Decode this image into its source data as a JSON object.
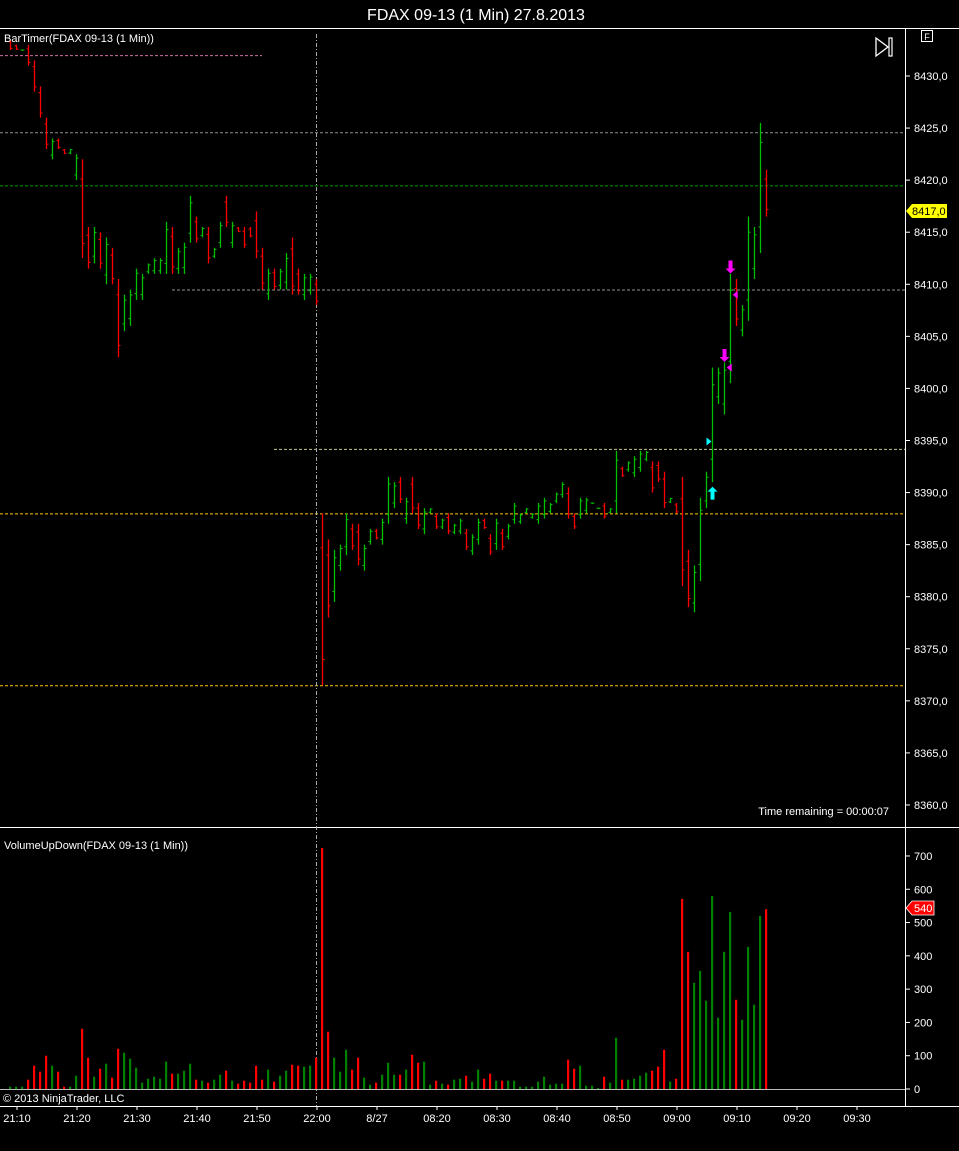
{
  "window": {
    "title": "FDAX 09-13 (1 Min)  27.8.2013"
  },
  "price_panel": {
    "indicator_label": "BarTimer(FDAX 09-13 (1 Min))",
    "time_remaining": "Time remaining = 00:00:07",
    "last_price_tag": "8417,0",
    "scroll_end_icon": "scroll-to-end-icon",
    "f_button": "F"
  },
  "volume_panel": {
    "indicator_label": "VolumeUpDown(FDAX 09-13 (1 Min))",
    "last_volume_tag": "540",
    "copyright": "© 2013 NinjaTrader, LLC"
  },
  "colors": {
    "up": "#00c000",
    "down": "#ff0000",
    "background": "#000000",
    "axis": "#ffffff",
    "price_tag": "#ffff00",
    "marker_buy": "#00ffff",
    "marker_sell": "#ff00ff"
  },
  "chart_data": [
    {
      "type": "ohlc",
      "title": "FDAX 09-13 (1 Min) 27.8.2013",
      "ylim": [
        8357,
        8436
      ],
      "y_ticks": [
        "8430,0",
        "8425,0",
        "8420,0",
        "8415,0",
        "8410,0",
        "8405,0",
        "8400,0",
        "8395,0",
        "8390,0",
        "8385,0",
        "8380,0",
        "8375,0",
        "8370,0",
        "8365,0",
        "8360,0"
      ],
      "y_tick_values": [
        8430,
        8425,
        8420,
        8415,
        8410,
        8405,
        8400,
        8395,
        8390,
        8385,
        8380,
        8375,
        8370,
        8365,
        8360
      ],
      "x_ticks": [
        "21:10",
        "21:20",
        "21:30",
        "21:40",
        "21:50",
        "22:00",
        "8/27",
        "08:20",
        "08:30",
        "08:40",
        "08:50",
        "09:00",
        "09:10",
        "09:20",
        "09:30"
      ],
      "x_tick_bar_index": [
        1,
        11,
        21,
        31,
        41,
        51,
        61,
        71,
        81,
        91,
        101,
        111,
        121,
        131,
        141
      ],
      "bars_format": [
        "high",
        "low",
        "direction"
      ],
      "bars": [
        [
          8433.5,
          8432.5,
          "d"
        ],
        [
          8433,
          8432.5,
          "d"
        ],
        [
          8432.5,
          8432.5,
          "u"
        ],
        [
          8433,
          8431,
          "d"
        ],
        [
          8431.5,
          8428.5,
          "d"
        ],
        [
          8429,
          8426,
          "d"
        ],
        [
          8426,
          8423,
          "d"
        ],
        [
          8424,
          8422,
          "u"
        ],
        [
          8424,
          8423,
          "d"
        ],
        [
          8423,
          8422.5,
          "d"
        ],
        [
          8423,
          8422.5,
          "u"
        ],
        [
          8422.5,
          8420,
          "u"
        ],
        [
          8422,
          8412.5,
          "d"
        ],
        [
          8415.5,
          8411.5,
          "d"
        ],
        [
          8415.5,
          8412,
          "u"
        ],
        [
          8415,
          8411.5,
          "d"
        ],
        [
          8414.5,
          8410,
          "u"
        ],
        [
          8413.5,
          8410,
          "d"
        ],
        [
          8410.5,
          8403,
          "d"
        ],
        [
          8409,
          8405.5,
          "u"
        ],
        [
          8409.5,
          8406,
          "u"
        ],
        [
          8411.5,
          8408.5,
          "u"
        ],
        [
          8411,
          8408.5,
          "u"
        ],
        [
          8412,
          8411,
          "u"
        ],
        [
          8412.5,
          8411,
          "u"
        ],
        [
          8412.5,
          8411,
          "u"
        ],
        [
          8416,
          8411,
          "u"
        ],
        [
          8415.5,
          8411,
          "d"
        ],
        [
          8413.5,
          8411,
          "u"
        ],
        [
          8414,
          8411,
          "u"
        ],
        [
          8418.5,
          8414,
          "u"
        ],
        [
          8416.5,
          8414,
          "d"
        ],
        [
          8415.5,
          8414.5,
          "u"
        ],
        [
          8415.5,
          8412,
          "d"
        ],
        [
          8413.5,
          8412.5,
          "u"
        ],
        [
          8416,
          8413.5,
          "u"
        ],
        [
          8418.5,
          8415.5,
          "d"
        ],
        [
          8416,
          8413.5,
          "u"
        ],
        [
          8415.5,
          8415,
          "d"
        ],
        [
          8415.5,
          8413.5,
          "d"
        ],
        [
          8415.5,
          8414.5,
          "d"
        ],
        [
          8417,
          8412.5,
          "d"
        ],
        [
          8413.5,
          8409.5,
          "d"
        ],
        [
          8411.5,
          8408.5,
          "u"
        ],
        [
          8411.5,
          8409.5,
          "d"
        ],
        [
          8411.5,
          8409.5,
          "u"
        ],
        [
          8413,
          8409.5,
          "u"
        ],
        [
          8414.5,
          8409,
          "d"
        ],
        [
          8411.5,
          8409,
          "d"
        ],
        [
          8411,
          8408.5,
          "u"
        ],
        [
          8411,
          8409,
          "u"
        ],
        [
          8410.5,
          8408,
          "d"
        ],
        [
          8388,
          8371.5,
          "d"
        ],
        [
          8385.5,
          8378,
          "d"
        ],
        [
          8384.5,
          8379.5,
          "u"
        ],
        [
          8385,
          8382.5,
          "u"
        ],
        [
          8388,
          8384,
          "u"
        ],
        [
          8387,
          8384.5,
          "d"
        ],
        [
          8387,
          8383,
          "d"
        ],
        [
          8385,
          8382.5,
          "u"
        ],
        [
          8386.5,
          8385,
          "u"
        ],
        [
          8386.5,
          8385.5,
          "d"
        ],
        [
          8387.5,
          8385,
          "u"
        ],
        [
          8391.5,
          8387,
          "u"
        ],
        [
          8391,
          8388.5,
          "u"
        ],
        [
          8391.5,
          8389,
          "d"
        ],
        [
          8389.5,
          8387,
          "u"
        ],
        [
          8391.5,
          8388,
          "d"
        ],
        [
          8389,
          8386.5,
          "d"
        ],
        [
          8388.5,
          8386,
          "u"
        ],
        [
          8388.5,
          8388,
          "u"
        ],
        [
          8388,
          8386.5,
          "d"
        ],
        [
          8387.5,
          8386.5,
          "u"
        ],
        [
          8388,
          8386,
          "d"
        ],
        [
          8387,
          8386,
          "u"
        ],
        [
          8387.5,
          8386,
          "u"
        ],
        [
          8386.5,
          8384.5,
          "d"
        ],
        [
          8386,
          8384,
          "u"
        ],
        [
          8387.5,
          8385,
          "u"
        ],
        [
          8387.5,
          8386.5,
          "d"
        ],
        [
          8386,
          8384,
          "d"
        ],
        [
          8387.5,
          8384.5,
          "u"
        ],
        [
          8386.5,
          8384.5,
          "d"
        ],
        [
          8387,
          8385.5,
          "u"
        ],
        [
          8389,
          8387,
          "u"
        ],
        [
          8388,
          8387,
          "u"
        ],
        [
          8388.5,
          8388,
          "u"
        ],
        [
          8388,
          8387.5,
          "u"
        ],
        [
          8389,
          8387,
          "u"
        ],
        [
          8389.5,
          8387.5,
          "u"
        ],
        [
          8389,
          8388,
          "u"
        ],
        [
          8390,
          8389,
          "u"
        ],
        [
          8391,
          8389.5,
          "u"
        ],
        [
          8390.5,
          8387.5,
          "d"
        ],
        [
          8388,
          8386.5,
          "d"
        ],
        [
          8389.5,
          8387.5,
          "u"
        ],
        [
          8389.5,
          8388,
          "u"
        ],
        [
          8389,
          8389,
          "u"
        ],
        [
          8388.5,
          8388.5,
          "u"
        ],
        [
          8389,
          8387.5,
          "d"
        ],
        [
          8388.5,
          8388,
          "u"
        ],
        [
          8394,
          8388,
          "u"
        ],
        [
          8392.5,
          8391.5,
          "d"
        ],
        [
          8393,
          8392,
          "u"
        ],
        [
          8393.5,
          8391.5,
          "u"
        ],
        [
          8394,
          8392,
          "u"
        ],
        [
          8394,
          8393,
          "u"
        ],
        [
          8393,
          8390,
          "d"
        ],
        [
          8393,
          8391,
          "d"
        ],
        [
          8392,
          8388.5,
          "d"
        ],
        [
          8389.5,
          8389,
          "u"
        ],
        [
          8389,
          8388,
          "d"
        ],
        [
          8391.5,
          8381,
          "d"
        ],
        [
          8384.5,
          8379,
          "d"
        ],
        [
          8383,
          8378.5,
          "u"
        ],
        [
          8389.5,
          8381.5,
          "u"
        ],
        [
          8392,
          8388.5,
          "u"
        ],
        [
          8402,
          8391,
          "u"
        ],
        [
          8402,
          8398.5,
          "u"
        ],
        [
          8402.5,
          8397.5,
          "u"
        ],
        [
          8411,
          8400.5,
          "u"
        ],
        [
          8410.5,
          8406,
          "d"
        ],
        [
          8408,
          8405,
          "u"
        ],
        [
          8416.5,
          8406.5,
          "u"
        ],
        [
          8415.5,
          8410.5,
          "u"
        ],
        [
          8425.5,
          8413,
          "u"
        ],
        [
          8421,
          8416.5,
          "d"
        ]
      ],
      "last_price": 8417.0,
      "horizontal_lines": [
        {
          "price": 8432.0,
          "color": "#d070a0",
          "from_bar": 0,
          "to_bar": 42
        },
        {
          "price": 8424.6,
          "color": "#909090",
          "from_bar": 0,
          "to_bar": null
        },
        {
          "price": 8419.5,
          "color": "#00a000",
          "from_bar": 0,
          "to_bar": null
        },
        {
          "price": 8409.5,
          "color": "#909090",
          "from_bar": 27,
          "to_bar": null
        },
        {
          "price": 8394.2,
          "color": "#c8c890",
          "from_bar": 44,
          "to_bar": null
        },
        {
          "price": 8388.0,
          "color": "#ffc800",
          "from_bar": 0,
          "to_bar": null
        },
        {
          "price": 8371.5,
          "color": "#ffc800",
          "from_bar": 0,
          "to_bar": null
        }
      ],
      "session_break_bar": 51,
      "markers": [
        {
          "type": "arrow-up",
          "bar": 117,
          "price": 8389.8,
          "color": "#00ffff"
        },
        {
          "type": "triangle-right",
          "bar": 116.5,
          "price": 8394.9,
          "color": "#00ffff"
        },
        {
          "type": "arrow-down",
          "bar": 120,
          "price": 8411.8,
          "color": "#ff00ff"
        },
        {
          "type": "arrow-down",
          "bar": 119,
          "price": 8403.3,
          "color": "#ff00ff"
        },
        {
          "type": "triangle-left",
          "bar": 120.7,
          "price": 8409.0,
          "color": "#ff00ff"
        },
        {
          "type": "triangle-left",
          "bar": 119.7,
          "price": 8402.0,
          "color": "#ff00ff"
        }
      ]
    },
    {
      "type": "bar",
      "title": "VolumeUpDown(FDAX 09-13 (1 Min))",
      "ylim": [
        0,
        760
      ],
      "y_ticks": [
        "700",
        "600",
        "500",
        "400",
        "300",
        "200",
        "100",
        "0"
      ],
      "y_tick_values": [
        700,
        600,
        500,
        400,
        300,
        200,
        100,
        0
      ],
      "volumes_format": [
        "volume",
        "direction"
      ],
      "volumes": [
        [
          7,
          "u"
        ],
        [
          7,
          "u"
        ],
        [
          7,
          "u"
        ],
        [
          28,
          "d"
        ],
        [
          70,
          "d"
        ],
        [
          52,
          "d"
        ],
        [
          100,
          "d"
        ],
        [
          70,
          "u"
        ],
        [
          52,
          "d"
        ],
        [
          7,
          "d"
        ],
        [
          7,
          "u"
        ],
        [
          40,
          "u"
        ],
        [
          181,
          "d"
        ],
        [
          94,
          "d"
        ],
        [
          37,
          "u"
        ],
        [
          61,
          "d"
        ],
        [
          76,
          "u"
        ],
        [
          34,
          "d"
        ],
        [
          121,
          "d"
        ],
        [
          109,
          "u"
        ],
        [
          91,
          "u"
        ],
        [
          64,
          "u"
        ],
        [
          19,
          "u"
        ],
        [
          31,
          "u"
        ],
        [
          37,
          "u"
        ],
        [
          31,
          "u"
        ],
        [
          82,
          "u"
        ],
        [
          46,
          "d"
        ],
        [
          46,
          "u"
        ],
        [
          55,
          "u"
        ],
        [
          76,
          "u"
        ],
        [
          28,
          "d"
        ],
        [
          25,
          "u"
        ],
        [
          19,
          "d"
        ],
        [
          28,
          "u"
        ],
        [
          43,
          "u"
        ],
        [
          55,
          "d"
        ],
        [
          25,
          "u"
        ],
        [
          16,
          "d"
        ],
        [
          25,
          "d"
        ],
        [
          19,
          "d"
        ],
        [
          70,
          "d"
        ],
        [
          28,
          "d"
        ],
        [
          58,
          "u"
        ],
        [
          22,
          "d"
        ],
        [
          40,
          "u"
        ],
        [
          55,
          "u"
        ],
        [
          73,
          "d"
        ],
        [
          70,
          "d"
        ],
        [
          67,
          "u"
        ],
        [
          70,
          "u"
        ],
        [
          94,
          "d"
        ],
        [
          724,
          "d"
        ],
        [
          172,
          "d"
        ],
        [
          94,
          "u"
        ],
        [
          52,
          "u"
        ],
        [
          118,
          "u"
        ],
        [
          58,
          "d"
        ],
        [
          94,
          "d"
        ],
        [
          34,
          "u"
        ],
        [
          13,
          "u"
        ],
        [
          19,
          "d"
        ],
        [
          43,
          "u"
        ],
        [
          79,
          "u"
        ],
        [
          43,
          "u"
        ],
        [
          43,
          "d"
        ],
        [
          58,
          "u"
        ],
        [
          103,
          "d"
        ],
        [
          79,
          "d"
        ],
        [
          82,
          "u"
        ],
        [
          13,
          "u"
        ],
        [
          25,
          "d"
        ],
        [
          16,
          "u"
        ],
        [
          13,
          "d"
        ],
        [
          28,
          "u"
        ],
        [
          31,
          "u"
        ],
        [
          40,
          "d"
        ],
        [
          22,
          "u"
        ],
        [
          58,
          "u"
        ],
        [
          31,
          "d"
        ],
        [
          46,
          "d"
        ],
        [
          25,
          "u"
        ],
        [
          25,
          "d"
        ],
        [
          25,
          "u"
        ],
        [
          25,
          "u"
        ],
        [
          7,
          "u"
        ],
        [
          7,
          "u"
        ],
        [
          7,
          "u"
        ],
        [
          22,
          "u"
        ],
        [
          37,
          "u"
        ],
        [
          13,
          "u"
        ],
        [
          16,
          "u"
        ],
        [
          16,
          "u"
        ],
        [
          88,
          "d"
        ],
        [
          61,
          "d"
        ],
        [
          70,
          "u"
        ],
        [
          10,
          "u"
        ],
        [
          10,
          "u"
        ],
        [
          3,
          "u"
        ],
        [
          37,
          "d"
        ],
        [
          19,
          "u"
        ],
        [
          154,
          "u"
        ],
        [
          28,
          "d"
        ],
        [
          28,
          "u"
        ],
        [
          31,
          "u"
        ],
        [
          40,
          "u"
        ],
        [
          49,
          "u"
        ],
        [
          55,
          "d"
        ],
        [
          67,
          "d"
        ],
        [
          118,
          "d"
        ],
        [
          22,
          "u"
        ],
        [
          31,
          "d"
        ],
        [
          571,
          "d"
        ],
        [
          412,
          "d"
        ],
        [
          319,
          "u"
        ],
        [
          355,
          "u"
        ],
        [
          265,
          "u"
        ],
        [
          580,
          "u"
        ],
        [
          214,
          "u"
        ],
        [
          412,
          "u"
        ],
        [
          532,
          "u"
        ],
        [
          268,
          "d"
        ],
        [
          208,
          "u"
        ],
        [
          427,
          "u"
        ],
        [
          253,
          "u"
        ],
        [
          520,
          "u"
        ],
        [
          540,
          "d"
        ]
      ],
      "last_volume": 540
    }
  ]
}
